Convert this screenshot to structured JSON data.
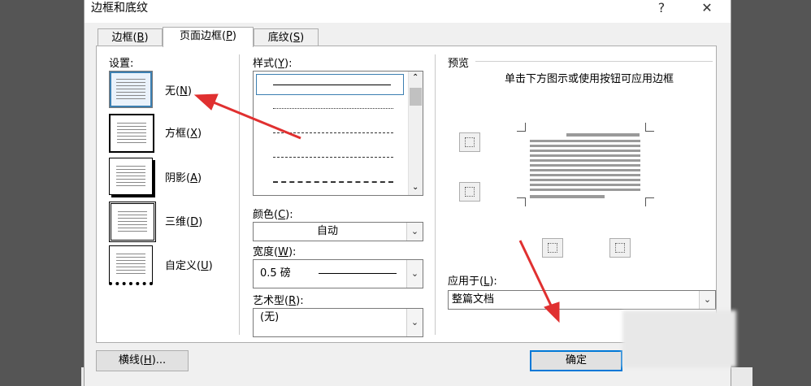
{
  "dialog": {
    "title": "边框和底纹",
    "help": "?",
    "close": "✕"
  },
  "tabs": [
    {
      "label": "边框(",
      "key": "B",
      "end": ")"
    },
    {
      "label": "页面边框(",
      "key": "P",
      "end": ")"
    },
    {
      "label": "底纹(",
      "key": "S",
      "end": ")"
    }
  ],
  "settings": {
    "heading": "设置:",
    "items": [
      {
        "label": "无(",
        "key": "N",
        "end": ")"
      },
      {
        "label": "方框(",
        "key": "X",
        "end": ")"
      },
      {
        "label": "阴影(",
        "key": "A",
        "end": ")"
      },
      {
        "label": "三维(",
        "key": "D",
        "end": ")"
      },
      {
        "label": "自定义(",
        "key": "U",
        "end": ")"
      }
    ]
  },
  "style": {
    "label": "样式(",
    "key": "Y",
    "end": "):"
  },
  "color": {
    "label": "颜色(",
    "key": "C",
    "end": "):",
    "value": "自动"
  },
  "width": {
    "label": "宽度(",
    "key": "W",
    "end": "):",
    "value": "0.5 磅"
  },
  "art": {
    "label": "艺术型(",
    "key": "R",
    "end": "):",
    "value": "(无)"
  },
  "preview": {
    "heading": "预览",
    "instruction": "单击下方图示或使用按钮可应用边框"
  },
  "apply": {
    "label": "应用于(",
    "key": "L",
    "end": "):",
    "value": "整篇文档"
  },
  "buttons": {
    "horizontal_line": "横线(",
    "horizontal_key": "H",
    "horizontal_end": ")...",
    "ok": "确定"
  },
  "colors": {
    "annotation_arrow": "#e03030",
    "selection": "#3c7fb1"
  }
}
